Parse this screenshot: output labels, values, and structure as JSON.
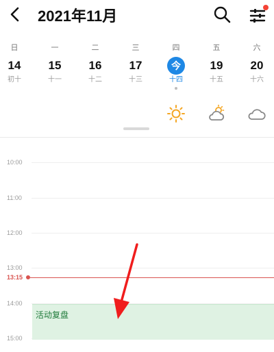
{
  "header": {
    "title": "2021年11月",
    "icons": {
      "back": "back-chevron-icon",
      "search": "search-icon",
      "filter": "filter-sliders-icon"
    },
    "notification_color": "#f44336"
  },
  "week": {
    "days": [
      {
        "dow": "日",
        "date": "14",
        "lunar": "初十"
      },
      {
        "dow": "一",
        "date": "15",
        "lunar": "十一"
      },
      {
        "dow": "二",
        "date": "16",
        "lunar": "十二"
      },
      {
        "dow": "三",
        "date": "17",
        "lunar": "十三"
      },
      {
        "dow": "四",
        "date": "今",
        "lunar": "十四"
      },
      {
        "dow": "五",
        "date": "19",
        "lunar": "十五"
      },
      {
        "dow": "六",
        "date": "20",
        "lunar": "十六"
      }
    ],
    "today_index": 4,
    "weather": [
      {
        "icon": "sunny-icon"
      },
      {
        "icon": "partly-cloudy-icon"
      },
      {
        "icon": "cloudy-icon"
      }
    ],
    "accent": "#1e88e5"
  },
  "timeline": {
    "hours": [
      "10:00",
      "11:00",
      "12:00",
      "13:00",
      "14:00",
      "15:00"
    ],
    "current_time": "13:15",
    "current_color": "#d9534f"
  },
  "events": [
    {
      "title": "活动复盘",
      "color": "#dff2e3"
    }
  ]
}
